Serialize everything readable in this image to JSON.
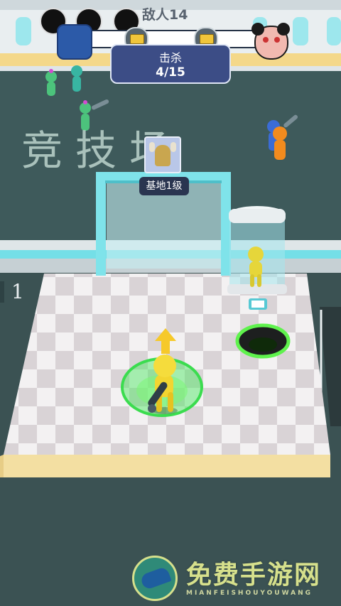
{
  "hud": {
    "enemy_label": "敌人14",
    "kill_title": "击杀",
    "kill_count": "4/15",
    "progress_fraction": 0.08
  },
  "arena": {
    "floor_text": "竞技场"
  },
  "base": {
    "label": "基地1级"
  },
  "lane_number": "1",
  "watermark": {
    "title": "免费手游网",
    "subtitle": "MIANFEISHOUYOUWANG"
  },
  "colors": {
    "hud_panel": "#3c4d86",
    "progress_fill": "#34c35a",
    "player": "#f2d531",
    "aura": "#44e85a",
    "arrow": "#f6c92a",
    "portal_frame": "#7fe3ea",
    "enemy": "#4cc37c"
  }
}
